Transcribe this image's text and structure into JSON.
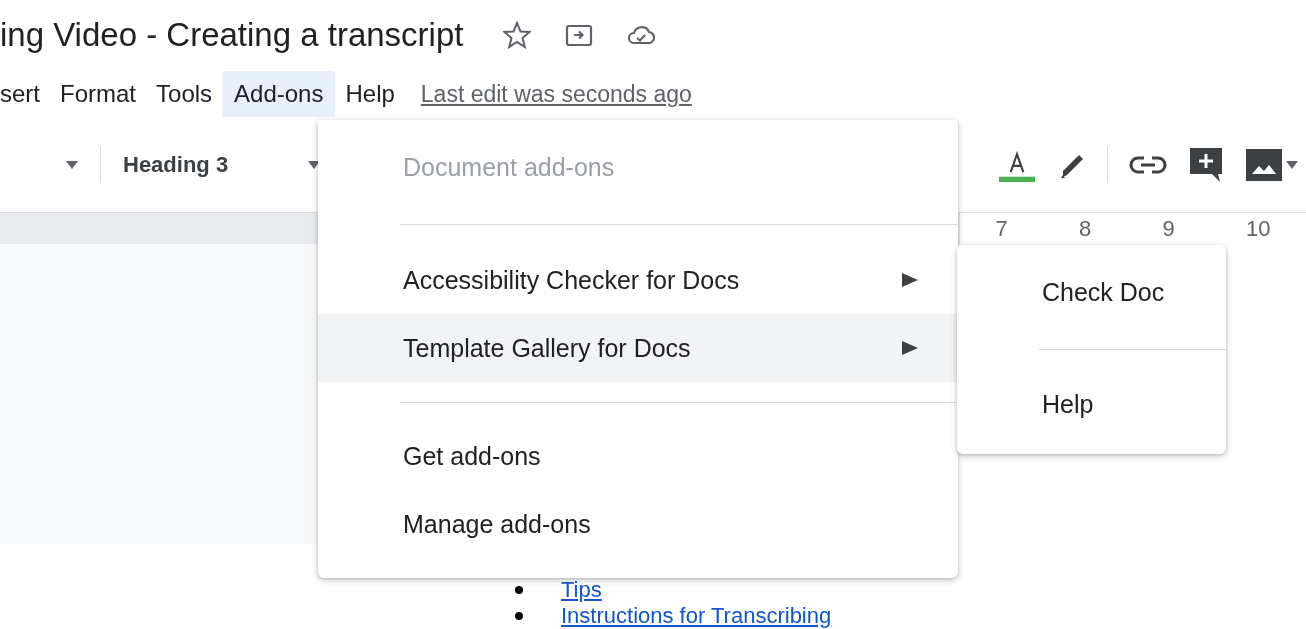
{
  "document_title": "ing Video - Creating a transcript",
  "menu_bar": [
    {
      "label": "sert",
      "selected": false
    },
    {
      "label": "Format",
      "selected": false
    },
    {
      "label": "Tools",
      "selected": false
    },
    {
      "label": "Add-ons",
      "selected": true
    },
    {
      "label": "Help",
      "selected": false
    }
  ],
  "last_edit": "Last edit was seconds ago",
  "toolbar": {
    "paragraph_style": "Heading 3"
  },
  "ruler": {
    "labels": [
      "7",
      "8",
      "9",
      "10"
    ]
  },
  "document": {
    "bullets": [
      "Tips",
      "Instructions for Transcribing"
    ]
  },
  "menu": {
    "items": [
      {
        "kind": "item",
        "label": "Document add-ons",
        "disabled": true,
        "submenu": false,
        "selected": false
      },
      {
        "kind": "separator"
      },
      {
        "kind": "item",
        "label": "Accessibility Checker for Docs",
        "disabled": false,
        "submenu": true,
        "selected": false
      },
      {
        "kind": "item",
        "label": "Template Gallery for Docs",
        "disabled": false,
        "submenu": true,
        "selected": true
      },
      {
        "kind": "separator"
      },
      {
        "kind": "item",
        "label": "Get add-ons",
        "disabled": false,
        "submenu": false,
        "selected": false
      },
      {
        "kind": "item",
        "label": "Manage add-ons",
        "disabled": false,
        "submenu": false,
        "selected": false
      }
    ]
  },
  "submenu": {
    "items": [
      {
        "kind": "item",
        "label": "Check Doc",
        "disabled": false,
        "submenu": false,
        "selected": false
      },
      {
        "kind": "separator"
      },
      {
        "kind": "item",
        "label": "Help",
        "disabled": false,
        "submenu": false,
        "selected": false
      }
    ]
  }
}
